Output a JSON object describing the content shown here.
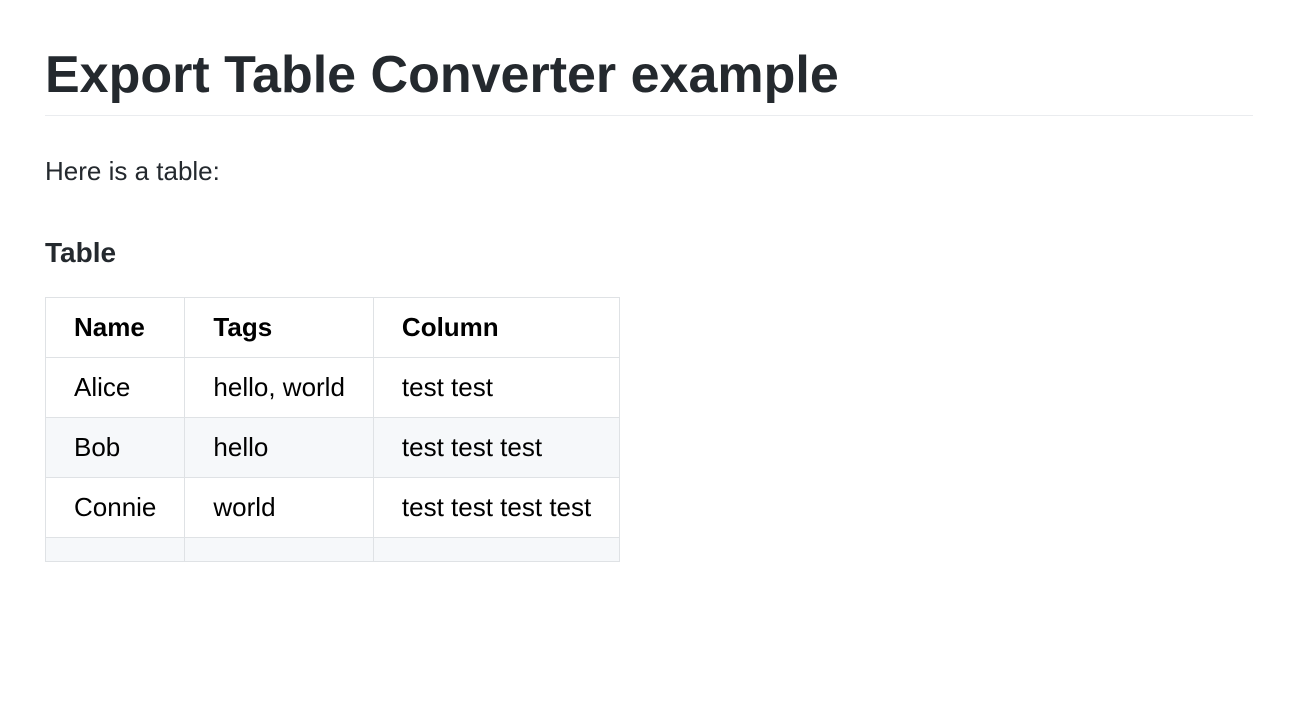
{
  "title": "Export Table Converter example",
  "intro": "Here is a table:",
  "table": {
    "heading": "Table",
    "headers": [
      "Name",
      "Tags",
      "Column"
    ],
    "rows": [
      [
        "Alice",
        "hello, world",
        "test test"
      ],
      [
        "Bob",
        "hello",
        "test test test"
      ],
      [
        "Connie",
        "world",
        "test test test test"
      ],
      [
        "",
        "",
        ""
      ]
    ]
  }
}
